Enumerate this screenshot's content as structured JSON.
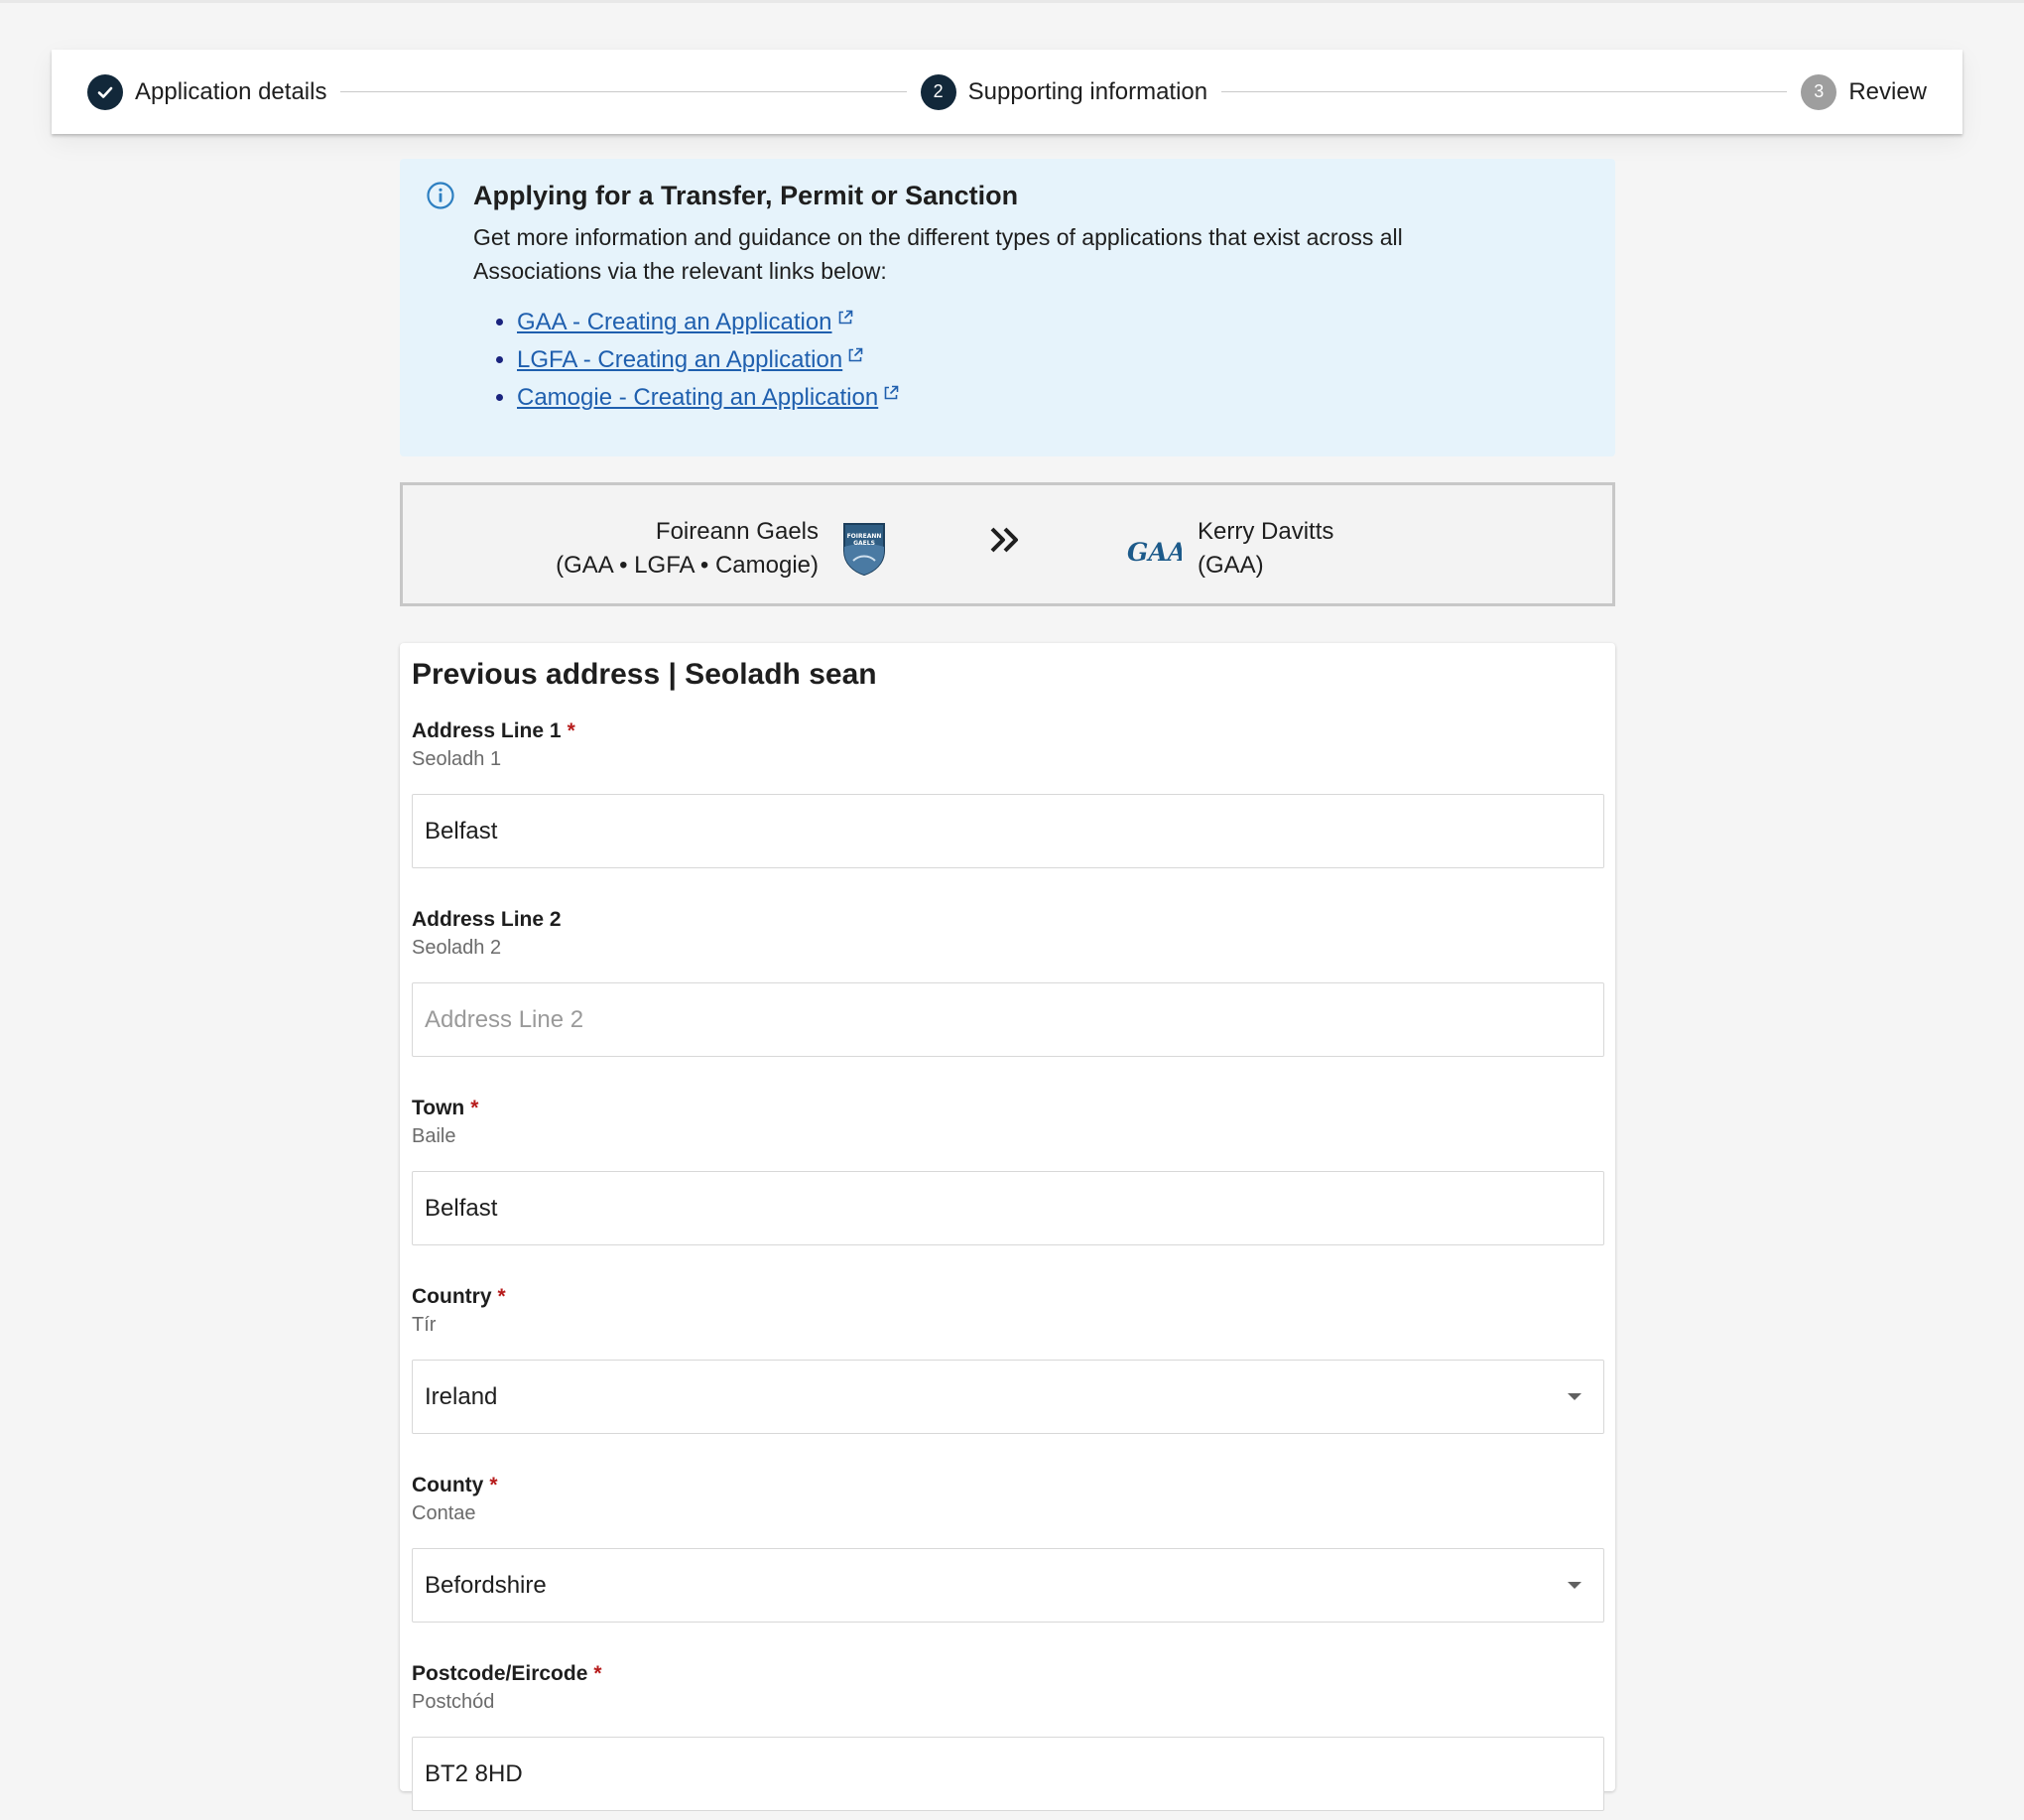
{
  "stepper": {
    "steps": [
      {
        "label": "Application details",
        "state": "complete",
        "icon": "check-icon"
      },
      {
        "label": "Supporting information",
        "number": "2",
        "state": "active"
      },
      {
        "label": "Review",
        "number": "3",
        "state": "pending"
      }
    ]
  },
  "info_alert": {
    "title": "Applying for a Transfer, Permit or Sanction",
    "body": "Get more information and guidance on the different types of applications that exist across all Associations via the relevant links below:",
    "links": [
      {
        "label": "GAA - Creating an Application"
      },
      {
        "label": "LGFA - Creating an Application"
      },
      {
        "label": "Camogie - Creating an Application"
      }
    ],
    "icon": "info-icon"
  },
  "transfer": {
    "from_club": "Foireann Gaels",
    "from_assocs": "(GAA • LGFA • Camogie)",
    "from_crest_text": "FOIREANN GAELS",
    "to_club": "Kerry Davitts",
    "to_assocs": "(GAA)",
    "arrow_icon": "double-chevron-right-icon",
    "to_logo": "GAA"
  },
  "form": {
    "title": "Previous address | Seoladh sean",
    "fields": [
      {
        "label": "Address Line 1",
        "sub": "Seoladh 1",
        "required": true,
        "value": "Belfast",
        "placeholder": ""
      },
      {
        "label": "Address Line 2",
        "sub": "Seoladh 2",
        "required": false,
        "value": "",
        "placeholder": "Address Line 2"
      },
      {
        "label": "Town",
        "sub": "Baile",
        "required": true,
        "value": "Belfast",
        "placeholder": ""
      },
      {
        "label": "Country",
        "sub": "Tír",
        "required": true,
        "value": "Ireland",
        "type": "select"
      },
      {
        "label": "County",
        "sub": "Contae",
        "required": true,
        "value": "Befordshire",
        "type": "select"
      },
      {
        "label": "Postcode/Eircode",
        "sub": "Postchód",
        "required": true,
        "value": "BT2 8HD",
        "placeholder": ""
      }
    ],
    "required_marker": "*"
  },
  "colors": {
    "stepper_active": "#12283a",
    "stepper_pending": "#9e9e9e",
    "alert_bg": "#e6f3fb",
    "link": "#1f5fae",
    "required": "#b71c1c"
  }
}
